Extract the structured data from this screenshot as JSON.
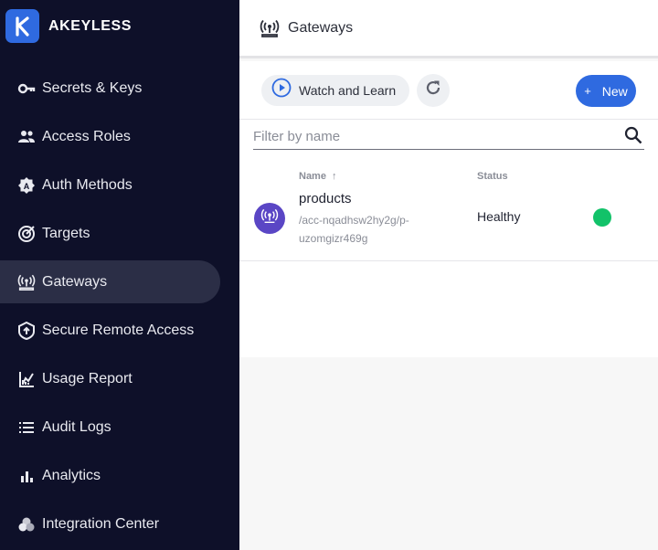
{
  "brand": {
    "name": "AKEYLESS",
    "logo_letter": "K",
    "accent": "#2f6ae0"
  },
  "sidebar": {
    "active_index": 4,
    "items": [
      {
        "label": "Secrets & Keys",
        "icon": "key-icon"
      },
      {
        "label": "Access Roles",
        "icon": "people-icon"
      },
      {
        "label": "Auth Methods",
        "icon": "auth-badge-icon"
      },
      {
        "label": "Targets",
        "icon": "target-icon"
      },
      {
        "label": "Gateways",
        "icon": "gateway-antenna-icon"
      },
      {
        "label": "Secure Remote Access",
        "icon": "shield-up-icon"
      },
      {
        "label": "Usage Report",
        "icon": "usage-chart-icon"
      },
      {
        "label": "Audit Logs",
        "icon": "list-icon"
      },
      {
        "label": "Analytics",
        "icon": "bar-chart-icon"
      },
      {
        "label": "Integration Center",
        "icon": "integration-icon"
      }
    ]
  },
  "header": {
    "title": "Gateways",
    "icon": "gateway-antenna-icon"
  },
  "toolbar": {
    "watch_label": "Watch and Learn",
    "refresh_icon": "refresh-icon",
    "new_label": "New",
    "new_icon": "plus-icon"
  },
  "filter": {
    "placeholder": "Filter by name",
    "value": "",
    "icon": "search-icon"
  },
  "table": {
    "columns": {
      "name": "Name",
      "name_sort": "↑",
      "status": "Status"
    },
    "rows": [
      {
        "name": "products",
        "path": "/acc-nqadhsw2hy2g/p-uzomgizr469g",
        "status": "Healthy",
        "status_color": "#12c269",
        "avatar_icon": "gateway-antenna-icon",
        "avatar_color": "#5a46c5"
      }
    ]
  }
}
